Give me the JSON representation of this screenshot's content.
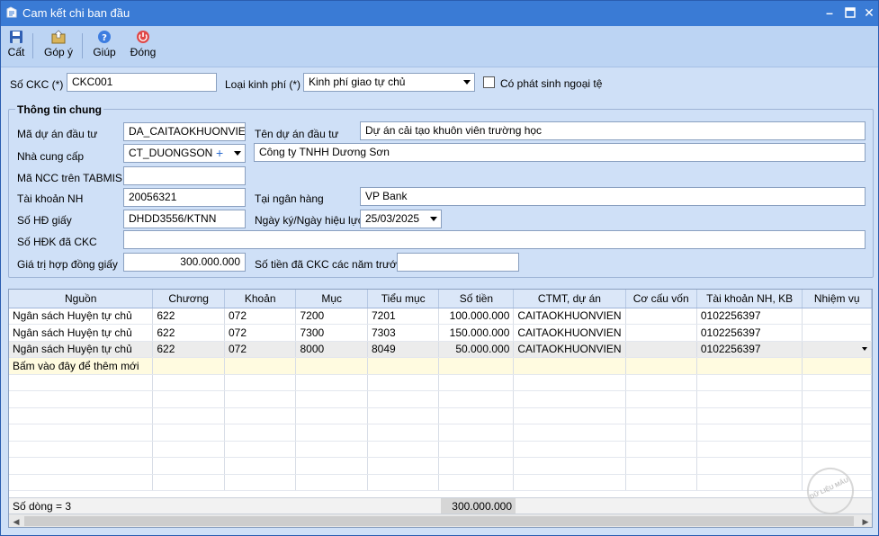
{
  "window": {
    "title": "Cam kết chi ban đầu"
  },
  "toolbar": {
    "save_label": "Cất",
    "feedback_label": "Góp ý",
    "help_label": "Giúp",
    "close_label": "Đóng"
  },
  "form": {
    "ckc_label": "Số CKC (*)",
    "ckc_value": "CKC001",
    "funding_label": "Loại kinh phí (*)",
    "funding_value": "Kinh phí giao tự chủ",
    "foreign_label": "Có phát sinh ngoại tệ"
  },
  "general": {
    "title": "Thông tin chung",
    "project_code_label": "Mã dự án đầu tư",
    "project_code_value": "DA_CAITAOKHUONVIE",
    "project_name_label": "Tên dự án đầu tư",
    "project_name_value": "Dự án cải tạo khuôn viên trường học",
    "supplier_label": "Nhà cung cấp",
    "supplier_code_value": "CT_DUONGSON",
    "supplier_name_value": "Công ty TNHH Dương Sơn",
    "tabmis_label": "Mã NCC trên TABMIS",
    "tabmis_value": "",
    "account_label": "Tài khoản NH",
    "account_value": "20056321",
    "bank_label": "Tại ngân hàng",
    "bank_value": "VP Bank",
    "contract_label": "Số HĐ giấy",
    "contract_value": "DHDD3556/KTNN",
    "sign_date_label": "Ngày ký/Ngày hiệu lực",
    "sign_date_value": "25/03/2025",
    "hdk_label": "Số HĐK đã CKC",
    "hdk_value": "",
    "contract_value_label": "Giá trị hợp đồng giấy",
    "contract_value_value": "300.000.000",
    "prev_years_label": "Số tiền đã CKC các năm trước",
    "prev_years_value": ""
  },
  "grid": {
    "columns": [
      "Nguồn",
      "Chương",
      "Khoản",
      "Mục",
      "Tiểu mục",
      "Số tiền",
      "CTMT, dự án",
      "Cơ cấu vốn",
      "Tài khoản NH, KB",
      "Nhiệm vụ"
    ],
    "rows": [
      [
        "Ngân sách Huyện tự chủ",
        "622",
        "072",
        "7200",
        "7201",
        "100.000.000",
        "CAITAOKHUONVIEN",
        "",
        "0102256397",
        ""
      ],
      [
        "Ngân sách Huyện tự chủ",
        "622",
        "072",
        "7300",
        "7303",
        "150.000.000",
        "CAITAOKHUONVIEN",
        "",
        "0102256397",
        ""
      ],
      [
        "Ngân sách Huyện tự chủ",
        "622",
        "072",
        "8000",
        "8049",
        "50.000.000",
        "CAITAOKHUONVIEN",
        "",
        "0102256397",
        ""
      ]
    ],
    "add_row_text": "Bấm vào đây để thêm mới",
    "row_count_text": "Số dòng = 3",
    "total_amount": "300.000.000"
  },
  "watermark": {
    "text": "DỮ LIỆU MẪU"
  },
  "colors": {
    "titlebar": "#3a7bd5",
    "toolbar": "#bcd4f3",
    "form_bg": "#cfe0f7",
    "new_row": "#fffbe0"
  },
  "icons": {
    "save": "floppy-icon",
    "feedback": "feedback-icon",
    "help": "help-icon",
    "close": "power-icon"
  }
}
